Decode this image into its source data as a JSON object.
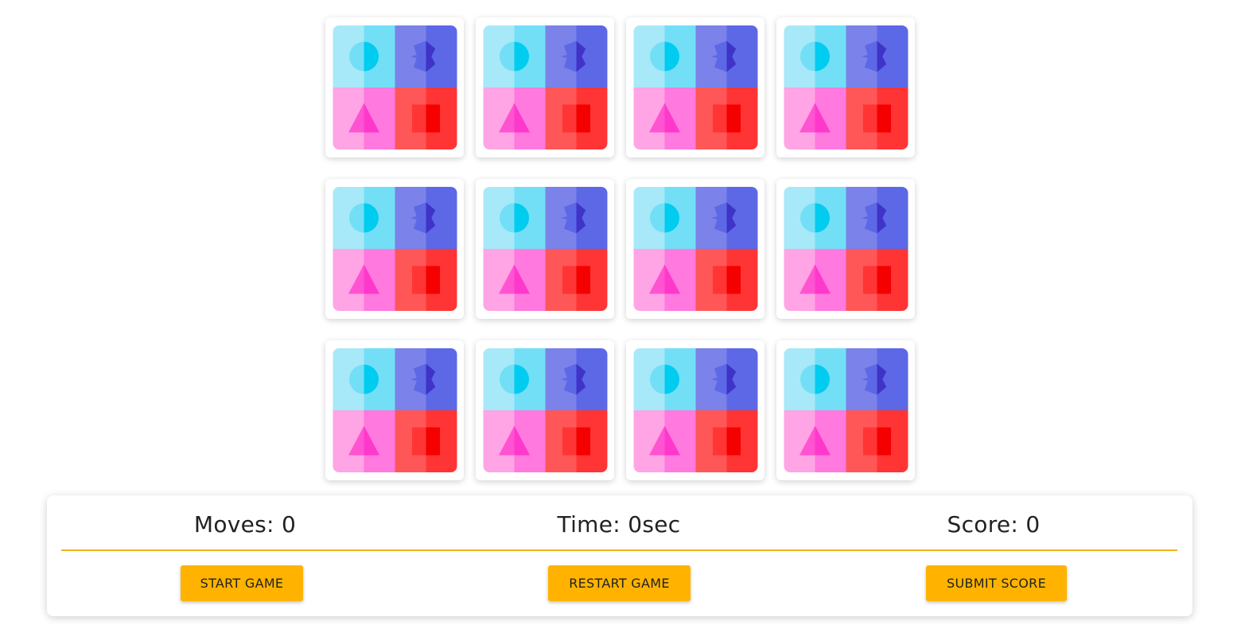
{
  "board": {
    "rows": 3,
    "columns": 4,
    "card_back_icon": "four-shapes-card-back-icon",
    "colors": {
      "cyan_light": "#a7e9f8",
      "cyan_mid": "#72dff7",
      "cyan_shape": "#00ccf0",
      "indigo_light": "#7b82e9",
      "indigo_mid": "#5c68e6",
      "indigo_shape": "#3f33c8",
      "pink_light": "#ffa4e4",
      "pink_mid": "#ff79df",
      "pink_shape": "#ff38cc",
      "red_light": "#ff5757",
      "red_mid": "#ff3535",
      "red_shape": "#f50000"
    }
  },
  "stats": {
    "moves": "Moves: 0",
    "time": "Time: 0sec",
    "score": "Score: 0"
  },
  "buttons": {
    "start": "START GAME",
    "restart": "RESTART GAME",
    "submit": "SUBMIT SCORE"
  },
  "theme": {
    "accent": "#ffb300",
    "divider": "#f2b21c",
    "text": "#222222"
  }
}
